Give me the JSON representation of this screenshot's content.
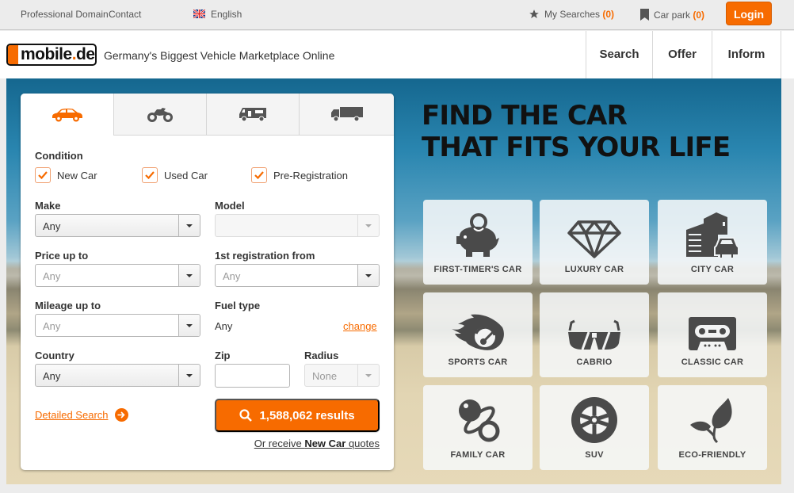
{
  "topbar": {
    "professional_domain": "Professional Domain",
    "contact": "Contact",
    "language": "English",
    "my_searches_label": "My Searches",
    "my_searches_count": "(0)",
    "car_park_label": "Car park",
    "car_park_count": "(0)",
    "login": "Login"
  },
  "header": {
    "logo_main": "mobile",
    "logo_dot": ".",
    "logo_tld": "de",
    "tagline": "Germany's Biggest Vehicle Marketplace Online",
    "nav": [
      "Search",
      "Offer",
      "Inform"
    ]
  },
  "search_panel": {
    "tabs": [
      {
        "icon": "car-icon",
        "active": true
      },
      {
        "icon": "motorbike-icon",
        "active": false
      },
      {
        "icon": "motorhome-icon",
        "active": false
      },
      {
        "icon": "truck-icon",
        "active": false
      }
    ],
    "condition": {
      "label": "Condition",
      "options": [
        {
          "label": "New Car",
          "checked": true
        },
        {
          "label": "Used Car",
          "checked": true
        },
        {
          "label": "Pre-Registration",
          "checked": true
        }
      ]
    },
    "make": {
      "label": "Make",
      "value": "Any"
    },
    "model": {
      "label": "Model",
      "value": ""
    },
    "price": {
      "label": "Price up to",
      "placeholder": "Any"
    },
    "first_registration": {
      "label": "1st registration from",
      "placeholder": "Any"
    },
    "mileage": {
      "label": "Mileage up to",
      "placeholder": "Any"
    },
    "fuel_type": {
      "label": "Fuel type",
      "value": "Any",
      "change_link": "change"
    },
    "country": {
      "label": "Country",
      "value": "Any"
    },
    "zip": {
      "label": "Zip",
      "value": ""
    },
    "radius": {
      "label": "Radius",
      "value": "None"
    },
    "detailed_search": "Detailed Search",
    "results_button": "1,588,062 results",
    "quotes": {
      "prefix": "Or receive ",
      "bold": "New Car",
      "suffix": " quotes"
    }
  },
  "hero": {
    "headline_line1": "FIND THE CAR",
    "headline_line2": "THAT FITS YOUR LIFE",
    "categories": [
      {
        "label": "FIRST-TIMER'S CAR",
        "icon": "piggy-bank-icon"
      },
      {
        "label": "LUXURY CAR",
        "icon": "diamond-icon"
      },
      {
        "label": "CITY CAR",
        "icon": "city-icon"
      },
      {
        "label": "SPORTS CAR",
        "icon": "speedometer-icon"
      },
      {
        "label": "CABRIO",
        "icon": "sunglasses-icon"
      },
      {
        "label": "CLASSIC CAR",
        "icon": "cassette-icon"
      },
      {
        "label": "FAMILY CAR",
        "icon": "pacifier-icon"
      },
      {
        "label": "SUV",
        "icon": "tire-icon"
      },
      {
        "label": "ECO-FRIENDLY",
        "icon": "leaf-icon"
      }
    ]
  },
  "colors": {
    "accent": "#f76b00",
    "text": "#333333",
    "icon_gray": "#4a4a4a"
  }
}
